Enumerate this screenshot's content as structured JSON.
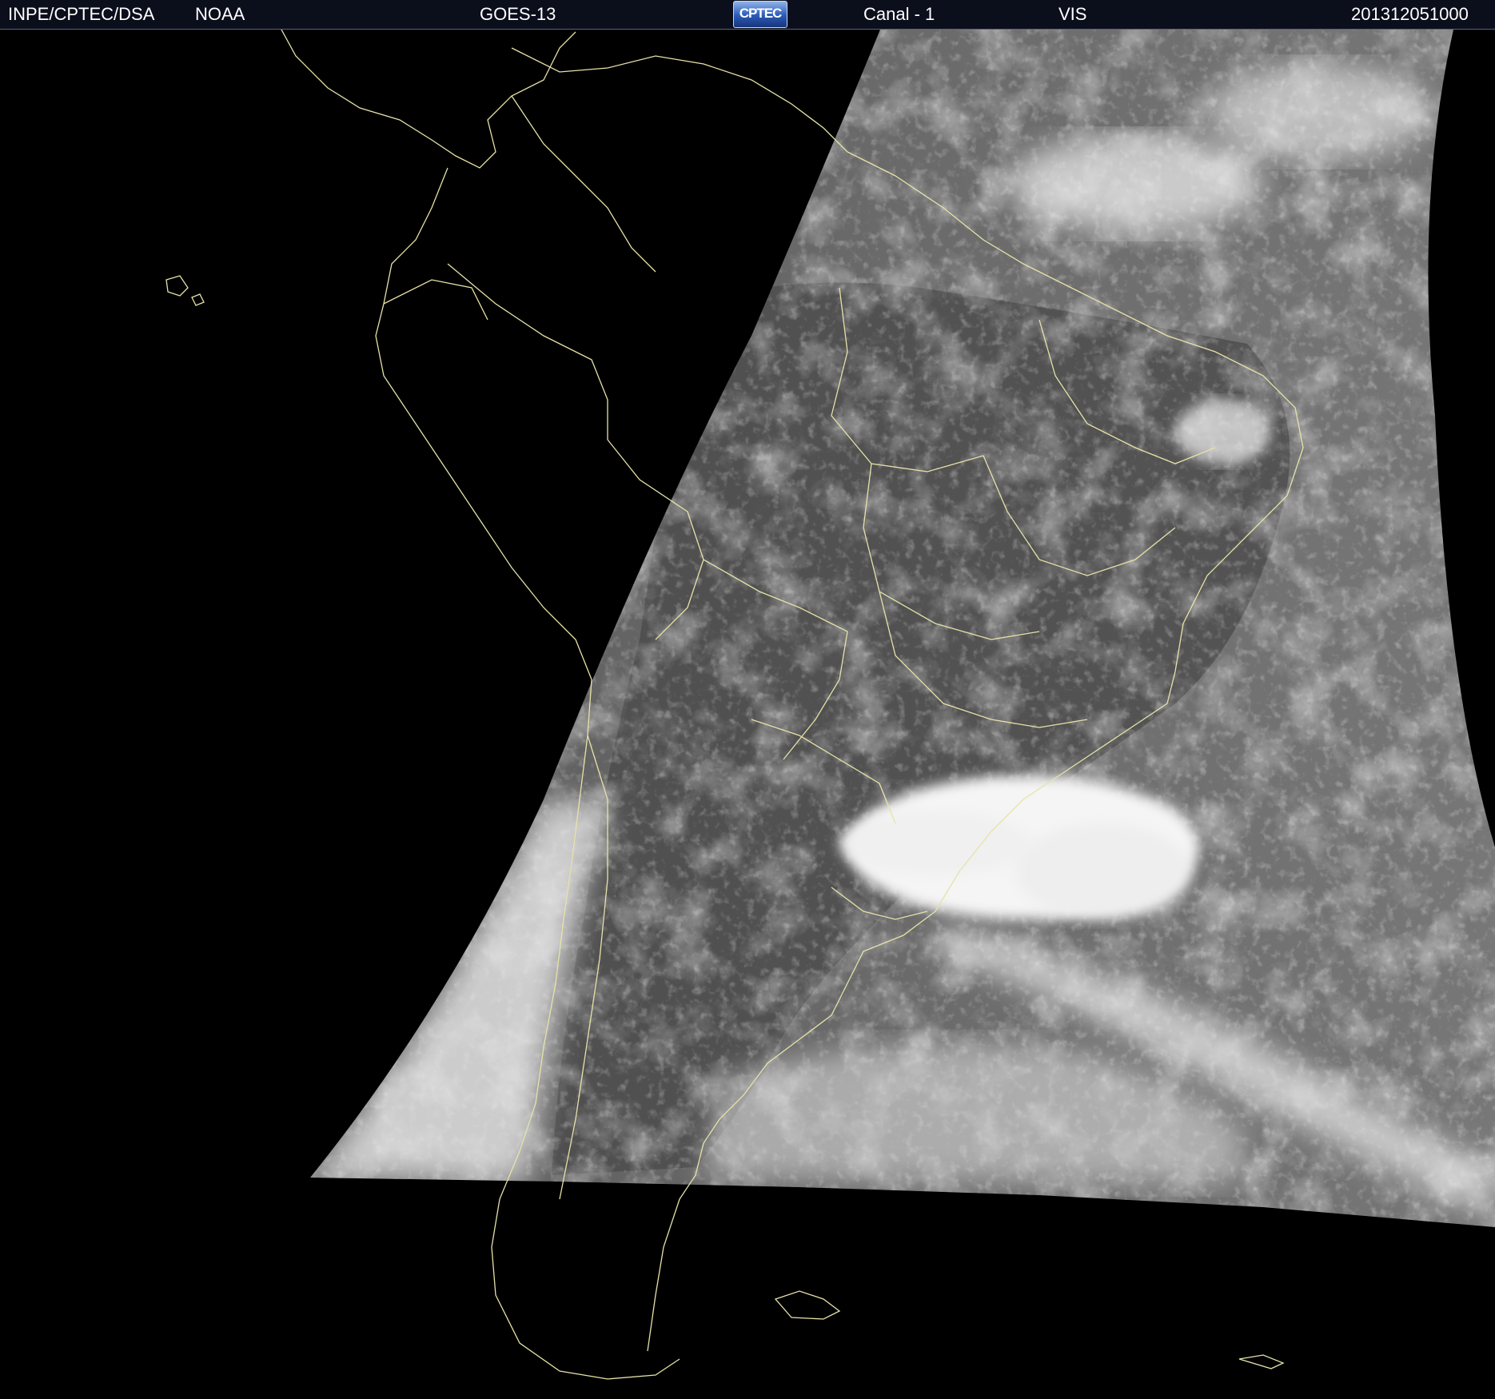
{
  "header": {
    "source": "INPE/CPTEC/DSA",
    "agency": "NOAA",
    "satellite": "GOES-13",
    "logo_text": "CPTEC",
    "channel": "Canal - 1",
    "band": "VIS",
    "timestamp": "201312051000"
  },
  "colors": {
    "header_bg": "#0b0f1c",
    "header_text": "#ffffff",
    "boundary_lines": "#e6e3a8",
    "space_bg": "#000000",
    "ocean_gray": "#6a6a6a",
    "cloud_white": "#f2f2f2"
  }
}
